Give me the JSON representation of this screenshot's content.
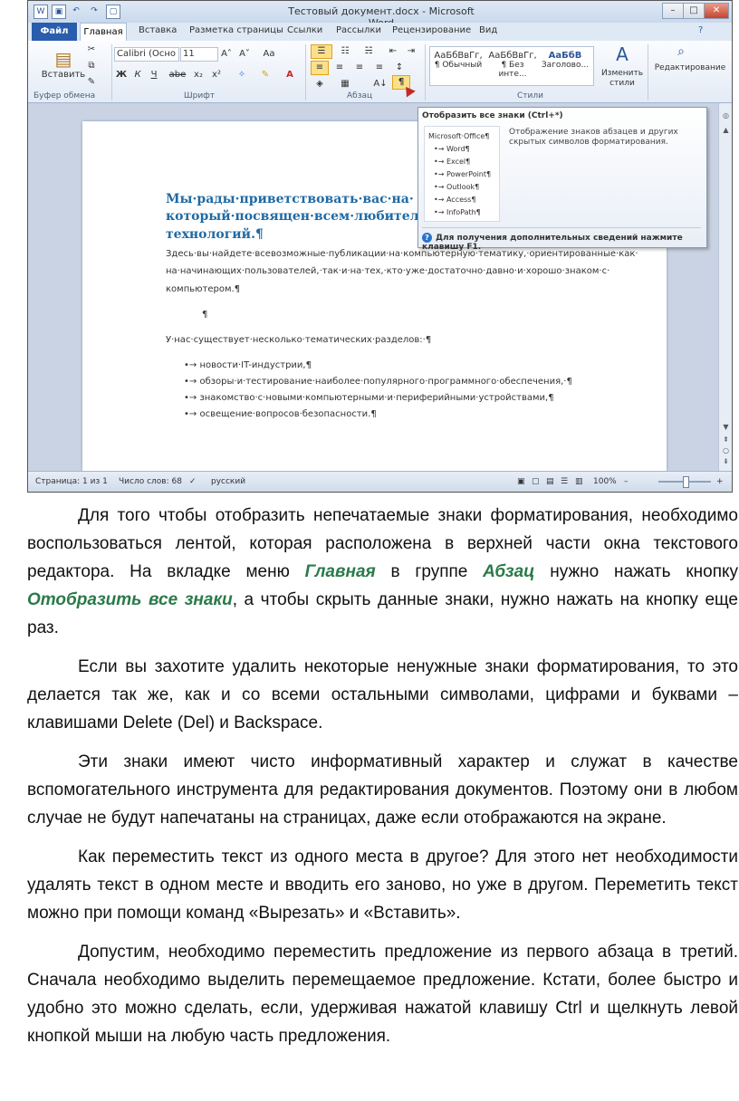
{
  "window": {
    "title": "Тестовый документ.docx - Microsoft Word",
    "minimize": "–",
    "maximize": "□",
    "close": "✕"
  },
  "menu": {
    "file": "Файл",
    "tabs": [
      "Главная",
      "Вставка",
      "Разметка страницы",
      "Ссылки",
      "Рассылки",
      "Рецензирование",
      "Вид"
    ]
  },
  "ribbon": {
    "paste": "Вставить",
    "clipboard_group": "Буфер обмена",
    "font_name": "Calibri (Осно",
    "font_size": "11",
    "font_group": "Шрифт",
    "bold": "Ж",
    "italic": "К",
    "underline": "Ч",
    "strike": "abe",
    "sub": "x₂",
    "sup": "x²",
    "grow": "A˄",
    "shrink": "A˅",
    "case": "Aa",
    "font_color": "A",
    "paragraph_group": "Абзац",
    "show_marks": "¶",
    "sort": "A↓",
    "styles_group": "Стили",
    "styles": [
      {
        "sample": "АаБбВвГг,",
        "name": "¶ Обычный"
      },
      {
        "sample": "АаБбВвГг,",
        "name": "¶ Без инте..."
      },
      {
        "sample": "АаБбВ",
        "name": "Заголово..."
      }
    ],
    "change_styles": "Изменить стили",
    "editing": "Редактирование"
  },
  "document": {
    "heading_lines": [
      "Мы·рады·приветствовать·вас·на·",
      "который·посвящен·всем·любител",
      "технологий.¶"
    ],
    "intro_lines": [
      "Здесь·вы·найдете·всевозможные·публикации·на·компьютерную·тематику,·ориентированные·как·",
      "на·начинающих·пользователей,·так·и·на·тех,·кто·уже·достаточно·давно·и·хорошо·знаком·с·",
      "компьютером.¶"
    ],
    "empty_mark": "¶",
    "sections_intro": "У·нас·существует·несколько·тематических·разделов:·¶",
    "bullets": [
      "•→ новости·IT-индустрии,¶",
      "•→ обзоры·и·тестирование·наиболее·популярного·программного·обеспечения,·¶",
      "•→ знакомство·с·новыми·компьютерными·и·периферийными·устройствами,¶",
      "•→ освещение·вопросов·безопасности.¶"
    ]
  },
  "tooltip": {
    "title": "Отобразить все знаки (Ctrl+*)",
    "preview": [
      "Microsoft·Office¶",
      "•→ Word¶",
      "•→ Excel¶",
      "•→ PowerPoint¶",
      "•→ Outlook¶",
      "•→ Access¶",
      "•→ InfoPath¶"
    ],
    "description": "Отображение знаков абзацев и других скрытых символов форматирования.",
    "footer": "Для получения дополнительных сведений нажмите клавишу F1."
  },
  "status": {
    "page": "Страница: 1 из 1",
    "words": "Число слов: 68",
    "language": "русский",
    "zoom": "100%",
    "zoom_minus": "–",
    "zoom_plus": "+"
  },
  "article": {
    "p1_a": "Для того чтобы отобразить непечатаемые знаки форматирования, необходимо воспользоваться лентой, которая расположена в верхней части окна текстового редактора. На вкладке меню ",
    "p1_b": "Главная",
    "p1_c": " в группе ",
    "p1_d": "Абзац",
    "p1_e": " нужно нажать кнопку ",
    "p1_f": "Отобразить все знаки",
    "p1_g": ", а чтобы скрыть данные знаки, нужно нажать на кнопку еще раз.",
    "p2": "Если вы захотите удалить некоторые ненужные знаки форматирования, то это делается так же, как и со всеми остальными символами, цифрами и буквами – клавишами Delete (Del) и Backspace.",
    "p3": "Эти знаки имеют чисто информативный характер и служат в качестве вспомогательного инструмента для редактирования документов. Поэтому они в любом случае не будут напечатаны на страницах, даже если отображаются на экране.",
    "p4": "Как переместить текст из одного места в другое? Для этого нет необходимости удалять текст в одном месте и вводить его заново, но уже в другом. Переметить текст можно при помощи команд «Вырезать» и «Вставить».",
    "p5": "Допустим, необходимо переместить предложение из первого абзаца в третий. Сначала необходимо выделить перемещаемое предложение. Кстати, более быстро и удобно это можно сделать, если, удерживая нажатой клавишу Ctrl и щелкнуть левой кнопкой мыши на любую часть предложения."
  }
}
